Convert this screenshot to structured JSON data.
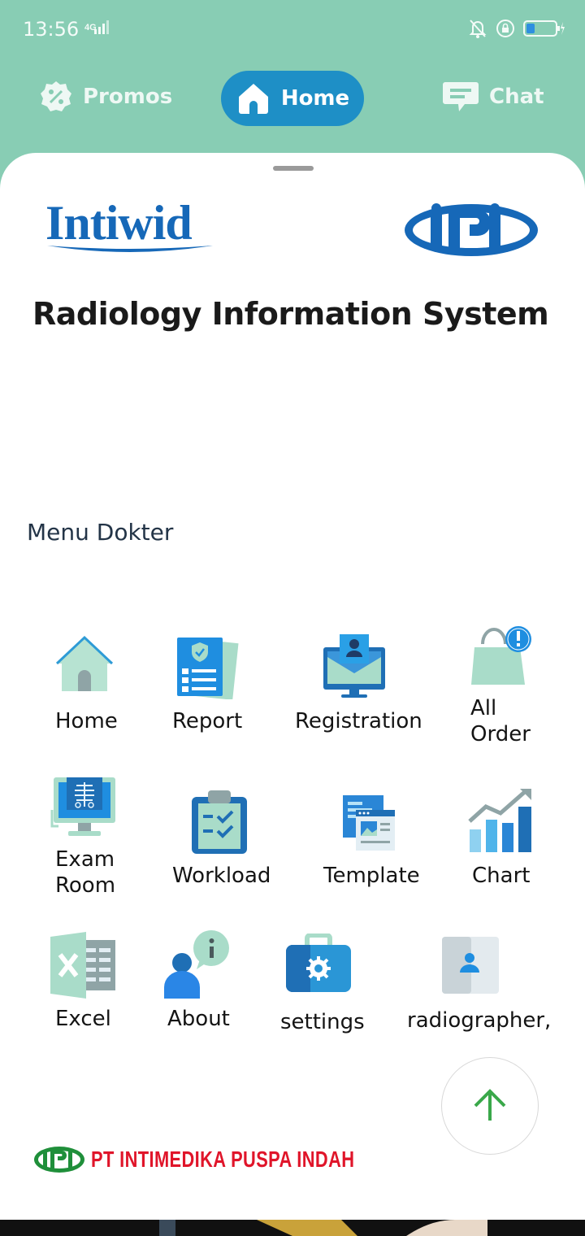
{
  "status": {
    "time": "13:56",
    "network": "4G"
  },
  "nav": {
    "promos": "Promos",
    "home": "Home",
    "chat": "Chat"
  },
  "brand": {
    "logo_left": "Intiwid",
    "logo_right": "IPI",
    "app_title": "Radiology Information System",
    "footer_logo": "IPI",
    "footer_company": "PT INTIMEDIKA PUSPA INDAH"
  },
  "menu": {
    "section_title": "Menu Dokter",
    "items": [
      {
        "label": "Home",
        "icon": "home-icon"
      },
      {
        "label": "Report",
        "icon": "report-icon"
      },
      {
        "label": "Registration",
        "icon": "registration-icon"
      },
      {
        "label": "All\nOrder",
        "line1": "All",
        "line2": "Order",
        "icon": "shopping-bag-icon"
      },
      {
        "label": "Exam\nRoom",
        "line1": "Exam",
        "line2": "Room",
        "icon": "xray-monitor-icon"
      },
      {
        "label": "Workload",
        "icon": "clipboard-icon"
      },
      {
        "label": "Template",
        "icon": "template-icon"
      },
      {
        "label": "Chart",
        "icon": "chart-icon"
      },
      {
        "label": "Excel",
        "icon": "excel-icon"
      },
      {
        "label": "About",
        "icon": "about-icon"
      },
      {
        "label": "settings",
        "icon": "settings-toolbox-icon"
      },
      {
        "label": "radiographer,",
        "icon": "radiographer-icon"
      }
    ]
  },
  "colors": {
    "header_bg": "#88cdb4",
    "active_tab": "#1e8fc6",
    "brand_blue": "#1668b8",
    "footer_red": "#e0152a",
    "footer_green": "#1f8f3a",
    "fab_arrow": "#3aa84a"
  }
}
